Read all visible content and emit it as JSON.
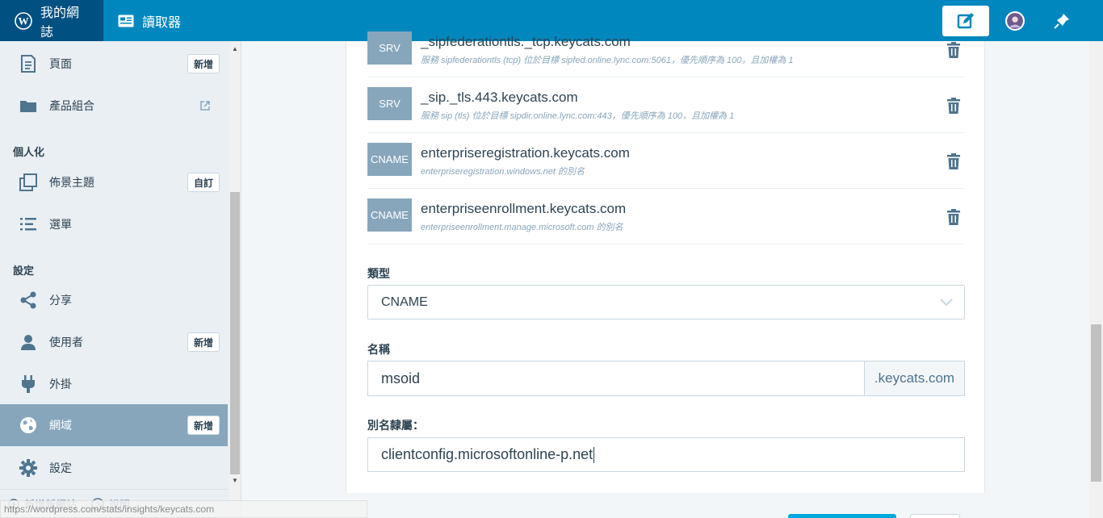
{
  "masterbar": {
    "my_site_label": "我的網誌",
    "reader_label": "讀取器",
    "icons": [
      "wordpress-icon",
      "reader-icon",
      "write-icon",
      "avatar",
      "notifications-icon"
    ]
  },
  "sidebar": {
    "items": [
      {
        "label": "頁面",
        "button": "新增",
        "icon": "page-icon"
      },
      {
        "label": "產品組合",
        "icon": "folder-icon"
      },
      {
        "label": "佈景主題",
        "button": "自訂",
        "icon": "themes-icon"
      },
      {
        "label": "選單",
        "icon": "menus-icon"
      },
      {
        "label": "分享",
        "icon": "share-icon"
      },
      {
        "label": "使用者",
        "button": "新增",
        "icon": "user-icon"
      },
      {
        "label": "外掛",
        "icon": "plugin-icon"
      },
      {
        "label": "網域",
        "button": "新增",
        "icon": "globe-icon"
      },
      {
        "label": "設定",
        "icon": "cog-icon"
      }
    ],
    "headings": {
      "personalize": "個人化",
      "configure": "設定"
    },
    "footer": {
      "add_site": "新增新網站",
      "help": "說明"
    },
    "status_url": "https://wordpress.com/stats/insights/keycats.com"
  },
  "records": [
    {
      "type": "SRV",
      "name": "_sipfederationtls._tcp.keycats.com",
      "desc": "服務 sipfederationtls (tcp) 位於目標 sipfed.online.lync.com:5061，優先順序為 100，且加權為 1"
    },
    {
      "type": "SRV",
      "name": "_sip._tls.443.keycats.com",
      "desc": "服務 sip (tls) 位於目標 sipdir.online.lync.com:443，優先順序為 100，且加權為 1"
    },
    {
      "type": "CNAME",
      "name": "enterpriseregistration.keycats.com",
      "desc": "enterpriseregistration.windows.net 的別名"
    },
    {
      "type": "CNAME",
      "name": "enterpriseenrollment.keycats.com",
      "desc": "enterpriseenrollment.manage.microsoft.com 的別名"
    }
  ],
  "form": {
    "type_label": "類型",
    "type_value": "CNAME",
    "name_label": "名稱",
    "name_value": "msoid",
    "name_suffix": ".keycats.com",
    "alias_label": "別名隸屬：",
    "alias_value": "clientconfig.microsoftonline-p.net"
  },
  "colors": {
    "masterbar": "#0087be",
    "masterbar_dark": "#005082",
    "sidebar_selected": "#87a6bc",
    "badge": "#87a6bc"
  }
}
